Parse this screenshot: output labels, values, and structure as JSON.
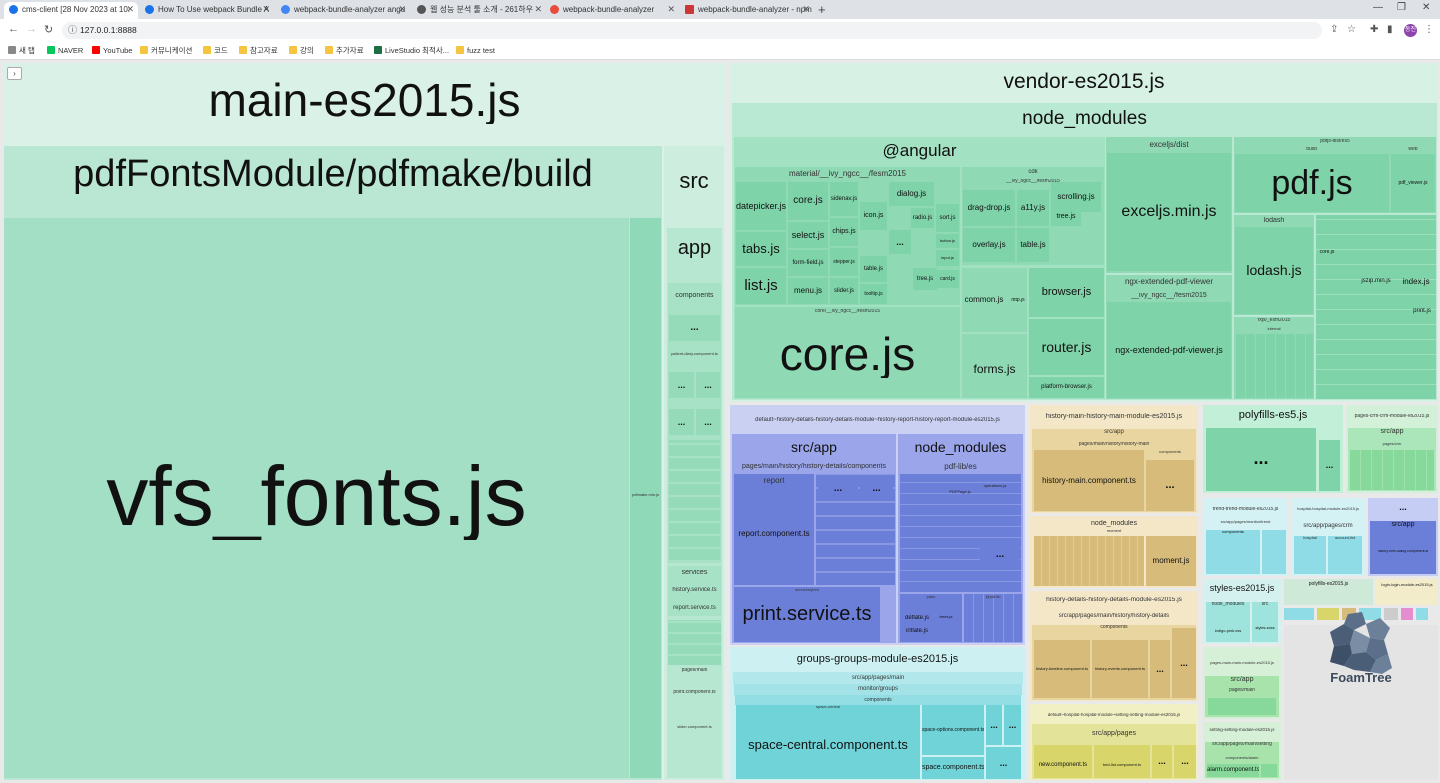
{
  "browser": {
    "tabs": [
      {
        "title": "cms-client [28 Nov 2023 at 10:",
        "active": true,
        "favicon": "#1a73e8"
      },
      {
        "title": "How To Use webpack Bundle A",
        "active": false,
        "favicon": "#1a73e8"
      },
      {
        "title": "webpack-bundle-analyzer angu",
        "active": false,
        "favicon": "#4285f4"
      },
      {
        "title": "웹 성능 분석 툴 소개 - 261하우",
        "active": false,
        "favicon": "#555555"
      },
      {
        "title": "webpack-bundle-analyzer",
        "active": false,
        "favicon": "#e74c3c"
      },
      {
        "title": "webpack-bundle-analyzer - npm",
        "active": false,
        "favicon": "#cb3837"
      }
    ],
    "url": "127.0.0.1:8888",
    "profile_initials": "동진",
    "bookmarks": [
      {
        "label": "새 탭",
        "color": "#888888"
      },
      {
        "label": "NAVER",
        "color": "#03c75a"
      },
      {
        "label": "YouTube",
        "color": "#ff0000"
      },
      {
        "label": "커뮤니케이션",
        "color": "#f5c542"
      },
      {
        "label": "코드",
        "color": "#f5c542"
      },
      {
        "label": "참고자료",
        "color": "#f5c542"
      },
      {
        "label": "강의",
        "color": "#f5c542"
      },
      {
        "label": "추가자료",
        "color": "#f5c542"
      },
      {
        "label": "LiveStudio 최적사...",
        "color": "#1d6f42"
      },
      {
        "label": "fuzz test",
        "color": "#f5c542"
      }
    ]
  },
  "labels": {
    "main_chunk": "main-es2015.js",
    "pdf_build": "pdfFontsModule/pdfmake/build",
    "vfs_fonts": "vfs_fonts.js",
    "pdfmake_min": "pdfmake.min.js",
    "src": "src",
    "app": "app",
    "components": "components",
    "patient_diary": "patient-diary.component.ts",
    "services": "services",
    "history_service": "history.service.ts",
    "report_service": "report.service.ts",
    "pages_main": "pages/main",
    "point_component": "point.component.ts",
    "slider_component": "slider.component.ts",
    "vendor_chunk": "vendor-es2015.js",
    "node_modules": "node_modules",
    "angular": "@angular",
    "material": "material/__ivy_ngcc__/fesm2015",
    "datepicker": "datepicker.js",
    "tabs": "tabs.js",
    "list": "list.js",
    "core_small": "core.js",
    "select": "select.js",
    "form_field": "form-field.js",
    "menu": "menu.js",
    "sidenav": "sidenav.js",
    "chips": "chips.js",
    "stepper": "stepper.js",
    "slider": "slider.js",
    "icon": "icon.js",
    "table": "table.js",
    "tooltip": "tooltip.js",
    "dialog": "dialog.js",
    "radio": "radio.js",
    "tree": "tree.js",
    "sort": "sort.js",
    "card": "card.js",
    "button": "button.js",
    "input": "input.js",
    "core_path": "core/__ivy_ngcc__/fesm2015",
    "core_big": "core.js",
    "cdk": "cdk",
    "cdk_path": "__ivy_ngcc__/fesm2015",
    "drag_drop": "drag-drop.js",
    "a11y": "a11y.js",
    "scrolling": "scrolling.js",
    "overlay": "overlay.js",
    "table_cdk": "table.js",
    "tree_cdk": "tree.js",
    "common": "common.js",
    "http": "http.js",
    "browser": "browser.js",
    "forms": "forms.js",
    "router": "router.js",
    "platform_browser": "platform-browser.js",
    "exceljs_dist": "exceljs/dist",
    "exceljs_min": "exceljs.min.js",
    "ngx_ext": "ngx-extended-pdf-viewer",
    "ngx_path": "__ivy_ngcc__/fesm2015",
    "ngx_file": "ngx-extended-pdf-viewer.js",
    "pdfjs_dist": "pdfjs-dist/es5",
    "pdf_build_small": "build",
    "pdf_js": "pdf.js",
    "web": "web",
    "pdf_viewer": "pdf_viewer.js",
    "lodash": "lodash",
    "lodash_js": "lodash.js",
    "rxjs": "rxjs/_esm2015",
    "internal": "internal",
    "jszip": "jszip.min.js",
    "index": "index.js",
    "print": "print.js",
    "dots": "...",
    "default_history": "default~history-details-history-details-module~history-report-history-report-module-es2015.js",
    "src_app": "src/app",
    "history_components_path": "pages/main/history/history-details/components",
    "report": "report",
    "report_component": "report.component.ts",
    "services_print": "services/print",
    "print_service": "print.service.ts",
    "pdf_lib": "pdf-lib/es",
    "pdf_doc": "PDFPage.js",
    "operations": "operations.js",
    "pako": "pako",
    "pdf_lib2": "@pdf-lib",
    "deflate": "deflate.js",
    "inflate": "inflate.js",
    "trees": "trees.js",
    "history_main": "history-main-history-main-module-es2015.js",
    "pages_history_main": "pages/main/history/history-main",
    "history_main_component": "history-main.component.ts",
    "moment_locale": "moment",
    "moment": "moment.js",
    "history_details": "history-details-history-details-module-es2015.js",
    "history_details_path": "src/app/pages/main/history/history-details",
    "history_timeline": "history-timeline.component.ts",
    "history_events": "history-events.component.ts",
    "default_hospital": "default~hospital-hospital-module~setting-setting-module-es2015.js",
    "src_app_pages": "src/app/pages",
    "new_component": "new.component.ts",
    "bed_list": "bed-list.component.ts",
    "groups": "groups-groups-module-es2015.js",
    "groups_path": "src/app/pages/main",
    "monitor_groups": "monitor/groups",
    "space_central_dir": "space-central",
    "space_central_component": "space-central.component.ts",
    "space_options": "space-options.component.ts",
    "space_component": "space.component.ts",
    "polyfills_es5": "polyfills-es5.js",
    "pages_crm": "pages-crm-crm-module-es2015.js",
    "pages_crm_path": "pages/crm",
    "trend": "trend-trend-module-es2015.js",
    "trend_path": "src/app/pages/monitor/trend",
    "hospital": "hospital-hospital-module-es2015.js",
    "hospital_path": "src/app/pages/crm",
    "hospital_dir": "hospital",
    "account_list": "account-list",
    "ellipsis": "...",
    "src_app2": "src/app",
    "history_new_dialog": "history-new-dialog.component.ts",
    "styles": "styles-es2015.js",
    "node_modules_small": "node_modules",
    "styles_scss": "styles.scss",
    "indigo_pink": "indigo-pink.css",
    "polyfills": "polyfills-es2015.js",
    "login": "login-login-module-es2015.js",
    "pages_main_module": "pages-main-main-module-es2015.js",
    "pages_main_sub": "pages/main",
    "setting_module": "setting-setting-module-es2015.js",
    "setting_path": "src/app/pages/main/setting",
    "alarm_component": "alarm.component.ts",
    "components_alarm": "components/alarm"
  },
  "brand": {
    "name": "FoamTree"
  },
  "colors": {
    "main": "#a3dfc5",
    "main_header": "#d9f1e6",
    "vendor": "#78d2a8",
    "vendor_header": "#d7f1e4",
    "blue": "#6c7fd8",
    "tan": "#d7bb7a",
    "teal": "#6fd3d7",
    "green": "#86d99a",
    "olive": "#d8d66a",
    "cyan": "#8fdbe6",
    "violet": "#9aa5ea"
  }
}
